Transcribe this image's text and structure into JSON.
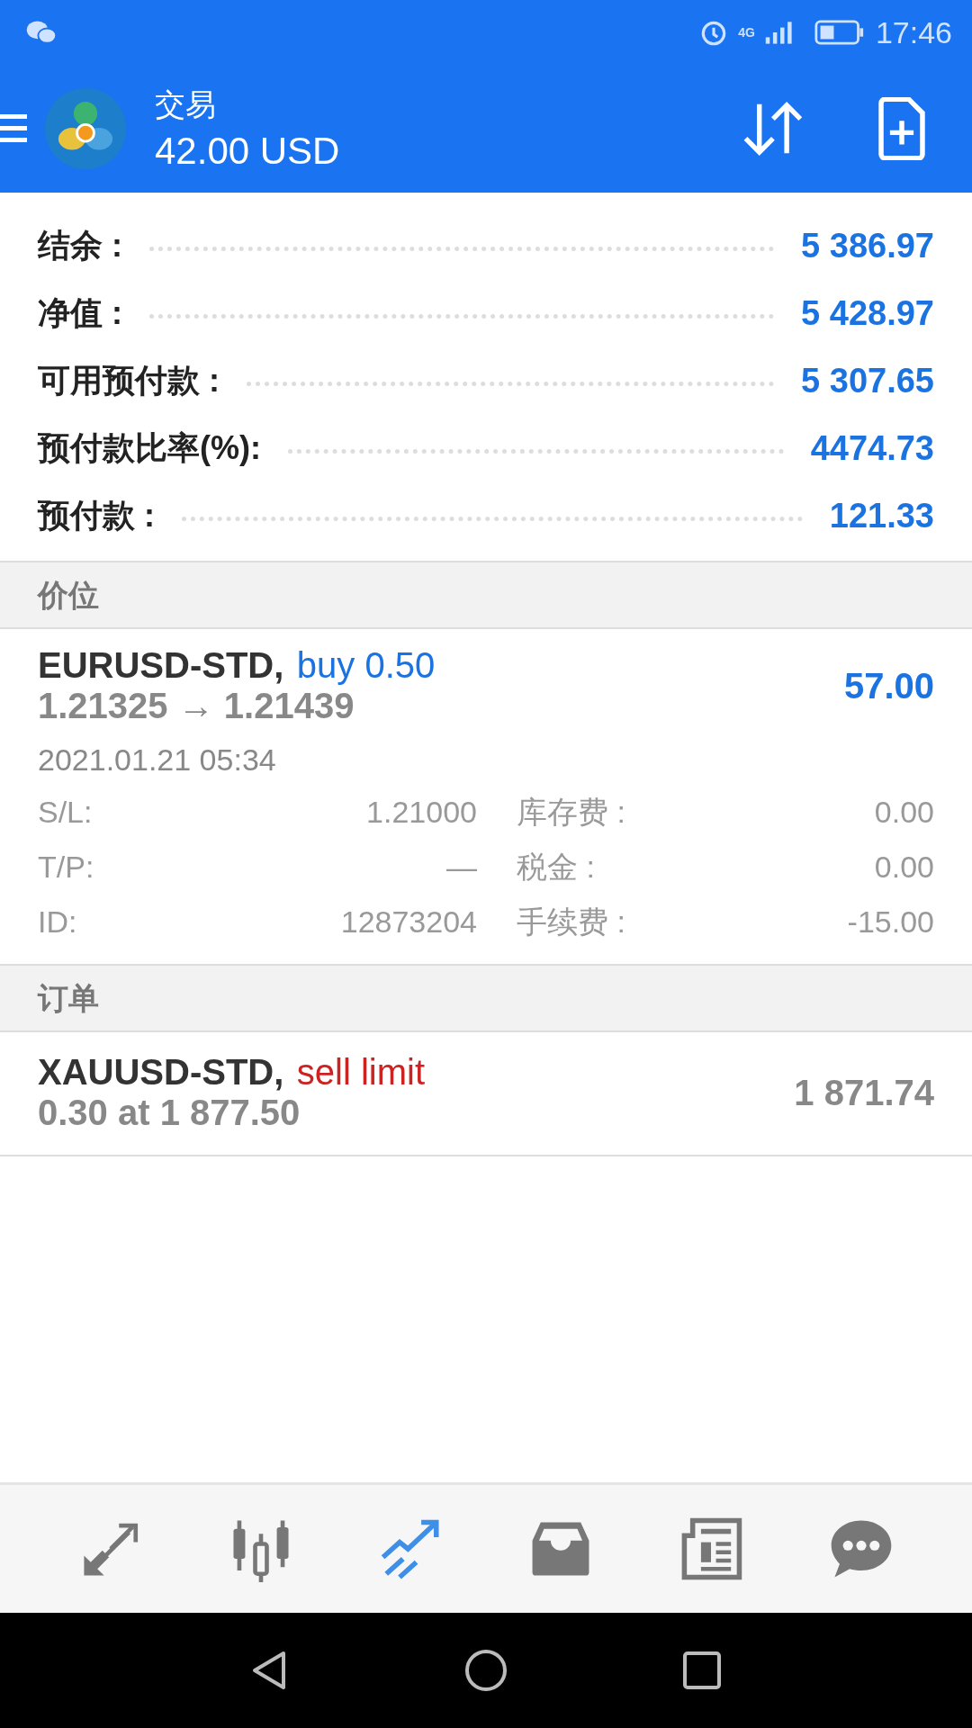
{
  "status_bar": {
    "network": "4G",
    "time": "17:46"
  },
  "header": {
    "title": "交易",
    "balance": "42.00 USD"
  },
  "summary": [
    {
      "label": "结余 :",
      "value": "5 386.97"
    },
    {
      "label": "净值 :",
      "value": "5 428.97"
    },
    {
      "label": "可用预付款 :",
      "value": "5 307.65"
    },
    {
      "label": "预付款比率(%):",
      "value": "4474.73"
    },
    {
      "label": "预付款 :",
      "value": "121.33"
    }
  ],
  "positions_section": {
    "title": "价位"
  },
  "positions": [
    {
      "symbol": "EURUSD-STD,",
      "kind": "buy",
      "action": "buy 0.50",
      "prices": "1.21325 → 1.21439",
      "profit": "57.00",
      "time": "2021.01.21 05:34",
      "details": [
        {
          "label": "S/L:",
          "value": "1.21000",
          "label_2": "库存费 :",
          "value_2": "0.00"
        },
        {
          "label": "T/P:",
          "value": "—",
          "label_2": "税金 :",
          "value_2": "0.00"
        },
        {
          "label": "ID:",
          "value": "12873204",
          "label_2": "手续费 :",
          "value_2": "-15.00"
        }
      ]
    }
  ],
  "orders_section": {
    "title": "订单"
  },
  "orders": [
    {
      "symbol": "XAUUSD-STD,",
      "kind": "sell",
      "action": "sell limit",
      "prices": "0.30 at 1 877.50",
      "price": "1 871.74"
    }
  ],
  "bottom_nav": [
    {
      "kind": "quotes",
      "selected": false
    },
    {
      "kind": "chart",
      "selected": false
    },
    {
      "kind": "trade",
      "selected": true
    },
    {
      "kind": "history",
      "selected": false
    },
    {
      "kind": "news",
      "selected": false
    },
    {
      "kind": "chat",
      "selected": false
    }
  ]
}
